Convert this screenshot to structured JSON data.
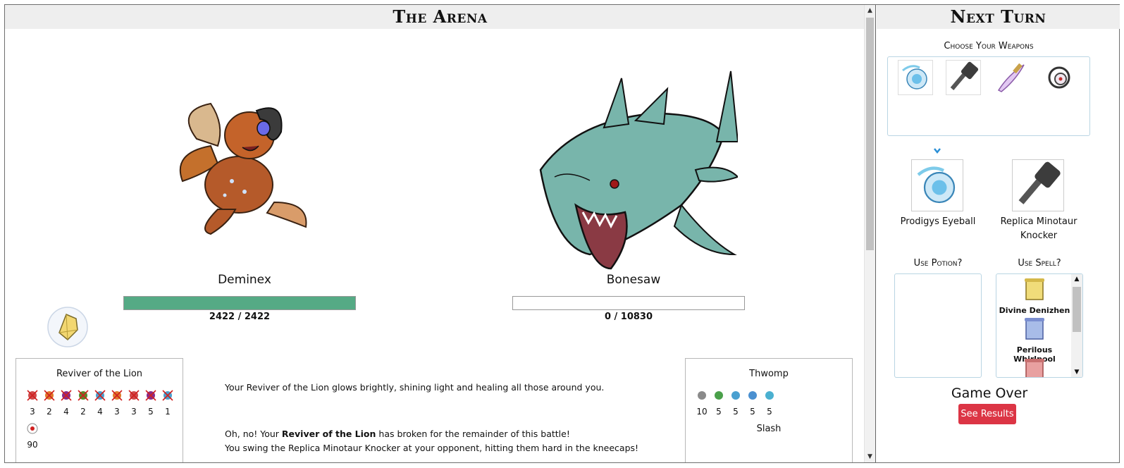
{
  "arena": {
    "title": "The Arena"
  },
  "player": {
    "name": "Deminex",
    "hp_text": "2422 / 2422",
    "hp_fraction": 1.0
  },
  "opponent": {
    "name": "Bonesaw",
    "hp_text": "0 / 10830",
    "hp_fraction": 0.0
  },
  "player_effects": {
    "title": "Reviver of the Lion",
    "row1": [
      "3",
      "2",
      "4",
      "2",
      "4",
      "3",
      "3",
      "5",
      "1"
    ],
    "row2": [
      "90"
    ]
  },
  "opponent_effects": {
    "title1": "Thwomp",
    "row1": [
      "10",
      "5",
      "5",
      "5",
      "5"
    ],
    "title2": "Slash"
  },
  "log": {
    "line1": "Your Reviver of the Lion glows brightly, shining light and healing all those around you.",
    "line2_pre": "Oh, no! Your ",
    "line2_bold": "Reviver of the Lion",
    "line2_post": " has broken for the remainder of this battle!",
    "line3": "You swing the Replica Minotaur Knocker at your opponent, hitting them hard in the kneecaps!"
  },
  "side": {
    "title": "Next Turn",
    "choose_weapons": "Choose Your Weapons",
    "chosen1": "Prodigys Eyeball",
    "chosen2": "Replica Minotaur Knocker",
    "use_potion": "Use Potion?",
    "use_spell": "Use Spell?",
    "spell1": "Divine Denizhen",
    "spell2": "Perilous Whirlpool",
    "game_over": "Game Over",
    "see_results": "See Results"
  },
  "colors": {
    "hp_fill": "#55aa85",
    "button": "#dc3545",
    "accent_border": "#b9d5e3",
    "arrow": "#2a8fd6"
  }
}
